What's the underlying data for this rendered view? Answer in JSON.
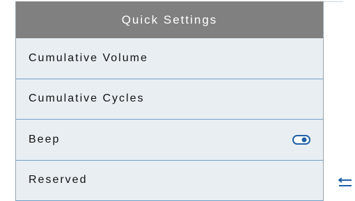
{
  "header": {
    "title": "Quick Settings"
  },
  "items": [
    {
      "label": "Cumulative Volume"
    },
    {
      "label": "Cumulative Cycles"
    },
    {
      "label": "Beep",
      "toggle": {
        "state": "on",
        "icon": "toggle-icon"
      }
    },
    {
      "label": "Reserved"
    }
  ],
  "controls": {
    "back_icon": "back-arrow-icon"
  },
  "colors": {
    "header_bg": "#808080",
    "panel_bg": "#e9eef3",
    "divider": "#6fa0c8",
    "accent": "#1f5fa8"
  }
}
